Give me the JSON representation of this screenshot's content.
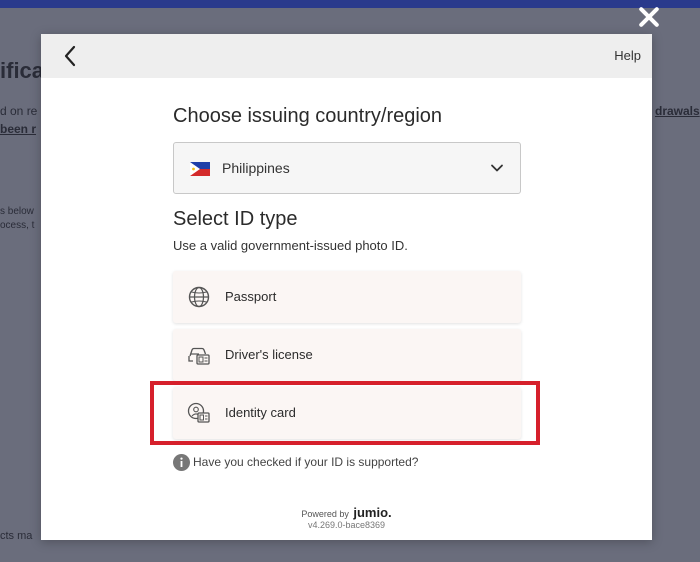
{
  "background": {
    "heading": "ificat",
    "line1": "d on re",
    "line2": "been r",
    "line3": "s below",
    "line4": "ocess, t",
    "right1": "drawals",
    "right2": "",
    "bottom": "cts ma"
  },
  "modal": {
    "back_icon": "chevron-left-icon",
    "help_label": "Help",
    "country_title": "Choose issuing country/region",
    "selected_country": "Philippines",
    "id_title": "Select ID type",
    "id_subtitle": "Use a valid government-issued photo ID.",
    "id_options": [
      {
        "label": "Passport",
        "icon": "globe-icon"
      },
      {
        "label": "Driver's license",
        "icon": "car-id-icon"
      },
      {
        "label": "Identity card",
        "icon": "id-card-icon"
      }
    ],
    "support_text": "Have you checked if your ID is supported?",
    "powered_by": "Powered by",
    "brand": "jumio.",
    "version": "v4.269.0-bace8369"
  },
  "colors": {
    "highlight": "#d6202b",
    "top_bar": "#2a3a8c",
    "overlay": "#6a6d7c"
  }
}
